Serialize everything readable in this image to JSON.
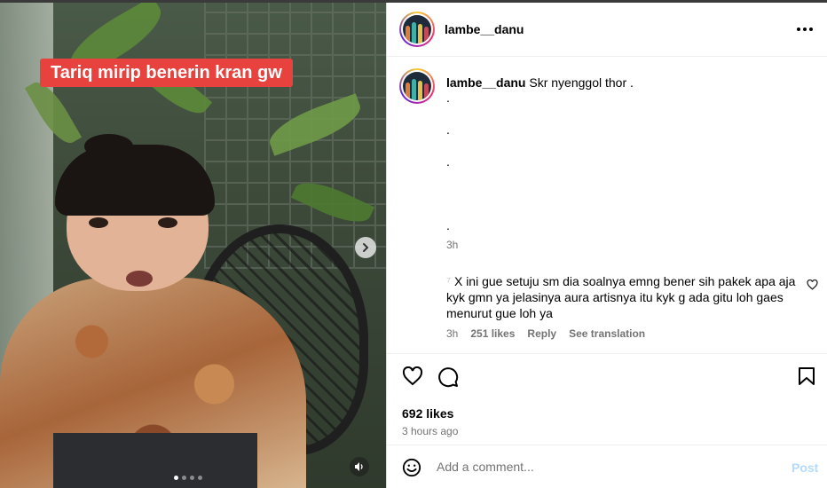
{
  "media": {
    "caption": "Tariq mirip benerin kran gw",
    "carousel_dots": 4,
    "active_dot": 0,
    "next_icon": "chevron-right-icon",
    "sound_icon": "speaker-icon"
  },
  "header": {
    "username": "lambe__danu",
    "more_icon": "more-horizontal-icon"
  },
  "post_caption": {
    "username": "lambe__danu",
    "text": "Skr nyenggol thor .",
    "lines": [
      ".",
      ".",
      ".",
      "."
    ],
    "time": "3h"
  },
  "reply": {
    "mention": "⁷",
    "text": "X ini gue setuju sm dia soalnya emng bener sih pakek apa aja kyk gmn ya jelasinya aura artisnya itu kyk g ada gitu loh gaes menurut gue loh ya",
    "time": "3h",
    "likes": "251 likes",
    "reply_label": "Reply",
    "translation_label": "See translation"
  },
  "actions": {
    "likes": "692 likes",
    "time_ago": "3 hours ago"
  },
  "add_comment": {
    "placeholder": "Add a comment...",
    "post_label": "Post"
  },
  "colors": {
    "caption_bg": "#e8423e",
    "post_button": "#b3dbff",
    "muted_text": "#737373"
  }
}
